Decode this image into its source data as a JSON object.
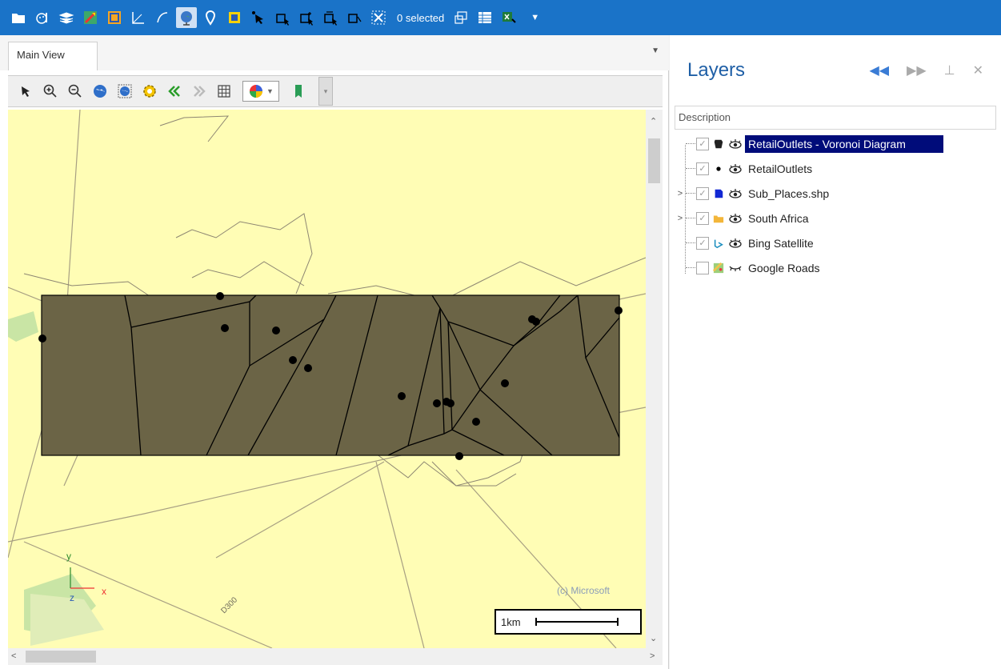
{
  "app": {
    "selection_count": "0 selected",
    "colors": {
      "titlebar": "#1a73c8",
      "selection": "#000c7a",
      "map_background": "#fffdb5",
      "voronoi_fill": "#6b6446",
      "layers_title": "#1f5fa6"
    },
    "top_toolbar_icons": [
      "folder-icon",
      "brush-settings-icon",
      "layers-stack-icon",
      "map-route-icon",
      "bing-icon",
      "measure-angle-icon",
      "edit-curve-icon",
      "globe-icon",
      "map-pin-icon",
      "frame-icon",
      "select-point-icon",
      "select-poly-icon",
      "select-poly-add-icon",
      "select-poly-edit-icon",
      "select-poly-remove-icon",
      "clear-selection-icon",
      "zoom-to-selection-icon",
      "attribute-table-icon",
      "export-excel-icon",
      "overflow-dropdown-icon"
    ]
  },
  "main_view": {
    "tab_label": "Main View",
    "toolbar_icons": [
      "pointer-icon",
      "zoom-in-icon",
      "zoom-out-icon",
      "full-extent-icon",
      "zoom-layer-icon",
      "settings-icon",
      "back-icon",
      "forward-icon",
      "grid-icon",
      "color-palette-icon",
      "bookmark-icon",
      "more-icon"
    ],
    "map": {
      "copyright": "(c) Microsoft",
      "scale_label": "1km",
      "road_label": "D300",
      "axis": {
        "y": "y",
        "x": "x",
        "z": "z"
      }
    }
  },
  "layers_panel": {
    "title": "Layers",
    "column_header": "Description",
    "items": [
      {
        "label": "RetailOutlets - Voronoi Diagram",
        "checked": true,
        "visible": true,
        "selected": true,
        "expandable": false,
        "icon": "polygon-layer-icon"
      },
      {
        "label": "RetailOutlets",
        "checked": true,
        "visible": true,
        "selected": false,
        "expandable": false,
        "icon": "point-layer-icon"
      },
      {
        "label": "Sub_Places.shp",
        "checked": true,
        "visible": true,
        "selected": false,
        "expandable": true,
        "icon": "shapefile-icon"
      },
      {
        "label": "South Africa",
        "checked": true,
        "visible": true,
        "selected": false,
        "expandable": true,
        "icon": "folder-icon"
      },
      {
        "label": "Bing Satellite",
        "checked": true,
        "visible": true,
        "selected": false,
        "expandable": false,
        "icon": "bing-icon"
      },
      {
        "label": "Google Roads",
        "checked": false,
        "visible": false,
        "selected": false,
        "expandable": false,
        "icon": "google-roads-icon"
      }
    ]
  }
}
